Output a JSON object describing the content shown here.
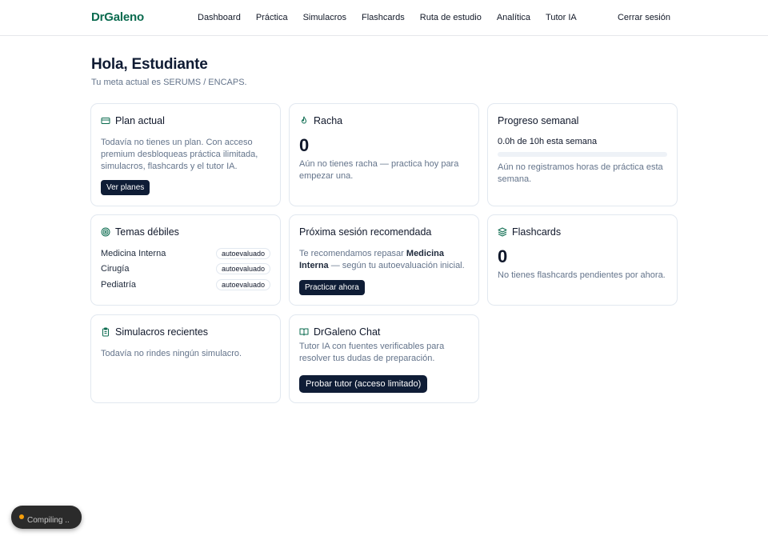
{
  "header": {
    "brand": "DrGaleno",
    "nav": [
      "Dashboard",
      "Práctica",
      "Simulacros",
      "Flashcards",
      "Ruta de estudio",
      "Analítica",
      "Tutor IA"
    ],
    "logout": "Cerrar sesión"
  },
  "greeting": {
    "title": "Hola, Estudiante",
    "subtitle": "Tu meta actual es SERUMS / ENCAPS."
  },
  "plan": {
    "icon": "credit-card-icon",
    "title": "Plan actual",
    "text": "Todavía no tienes un plan. Con acceso premium desbloqueas práctica ilimitada, simulacros, flashcards y el tutor IA.",
    "button": "Ver planes"
  },
  "streak": {
    "icon": "flame-icon",
    "title": "Racha",
    "value": "0",
    "text": "Aún no tienes racha — practica hoy para empezar una."
  },
  "weekly": {
    "title": "Progreso semanal",
    "label": "0.0h de 10h esta semana",
    "progress": 0,
    "text": "Aún no registramos horas de práctica esta semana."
  },
  "weak_topics": {
    "icon": "target-icon",
    "title": "Temas débiles",
    "items": [
      {
        "name": "Medicina Interna",
        "badge": "autoevaluado"
      },
      {
        "name": "Cirugía",
        "badge": "autoevaluado"
      },
      {
        "name": "Pediatría",
        "badge": "autoevaluado"
      }
    ]
  },
  "next_session": {
    "title": "Próxima sesión recomendada",
    "text_before": "Te recomendamos repasar ",
    "topic": "Medicina Interna",
    "text_after": " — según tu autoevaluación inicial.",
    "button": "Practicar ahora"
  },
  "flashcards": {
    "icon": "layers-icon",
    "title": "Flashcards",
    "value": "0",
    "text": "No tienes flashcards pendientes por ahora."
  },
  "recent_exams": {
    "icon": "clipboard-icon",
    "title": "Simulacros recientes",
    "text": "Todavía no rindes ningún simulacro."
  },
  "chat": {
    "icon": "book-open-icon",
    "title": "DrGaleno Chat",
    "text": "Tutor IA con fuentes verificables para resolver tus dudas de preparación.",
    "button": "Probar tutor (acceso limitado)"
  },
  "toast": {
    "text": "Compiling ..",
    "dot_color": "#f59e0b"
  },
  "colors": {
    "brand": "#0b6b4f",
    "button_bg": "#0f1d36",
    "muted_text": "#64748b"
  }
}
